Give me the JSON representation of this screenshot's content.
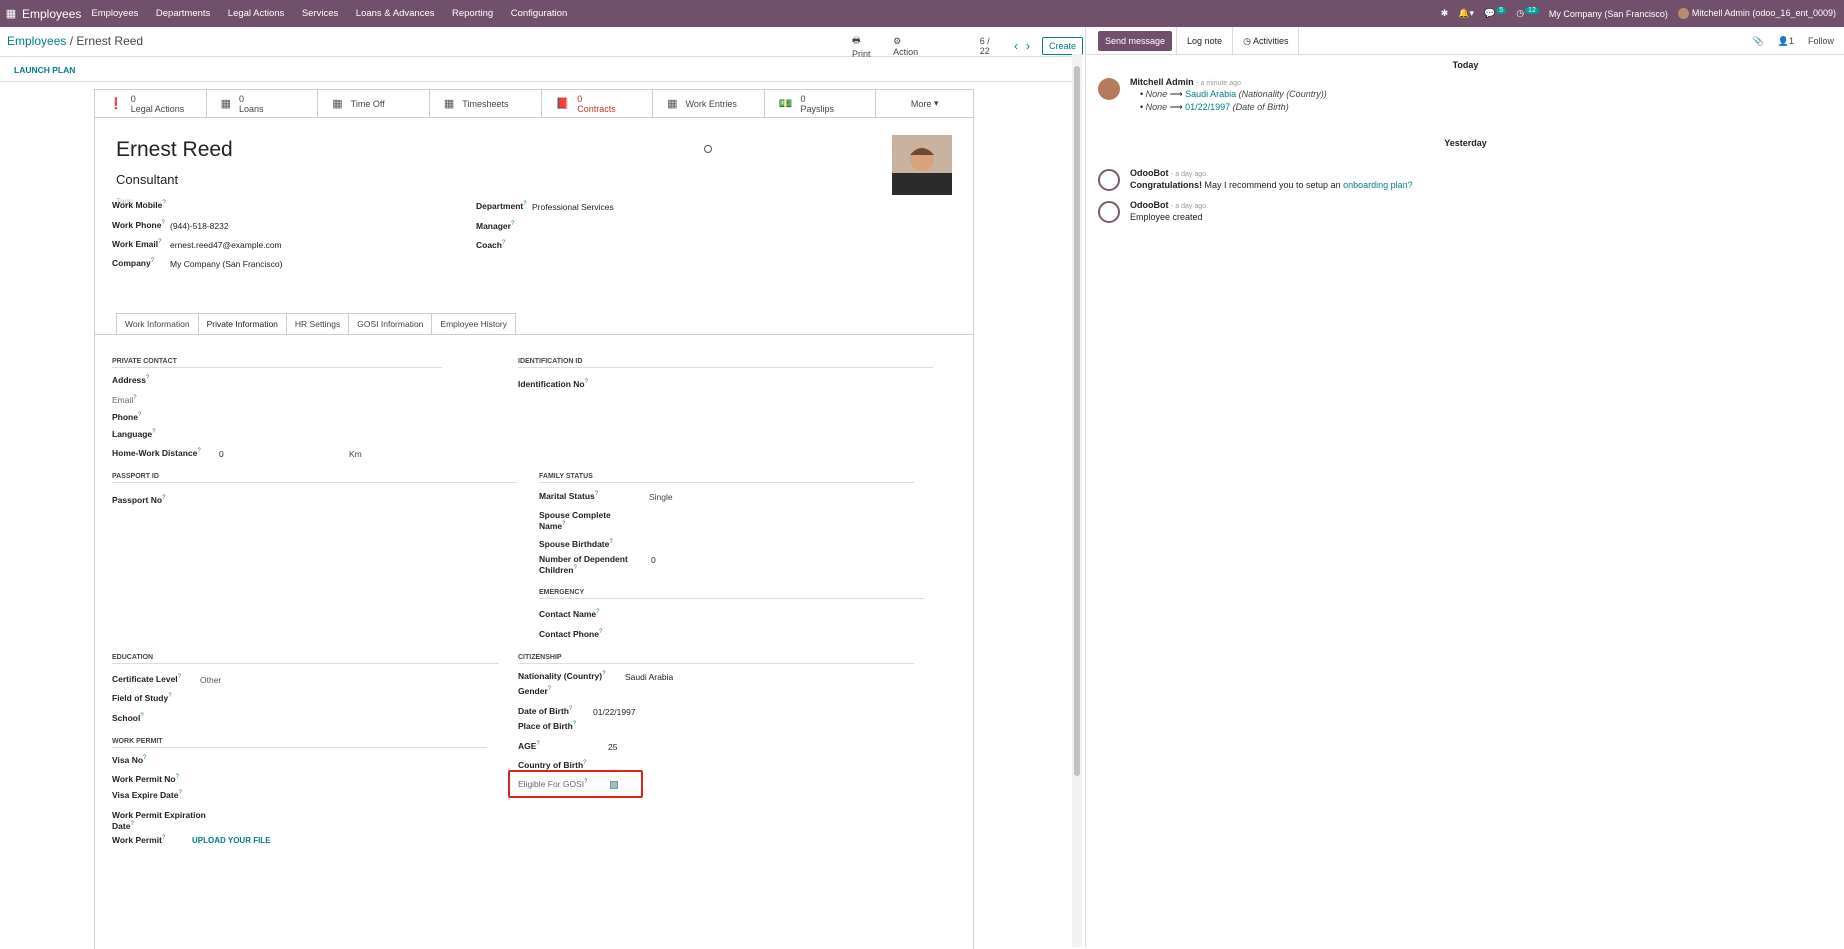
{
  "topbar": {
    "app_name": "Employees",
    "menu": [
      "Employees",
      "Departments",
      "Legal Actions",
      "Services",
      "Loans & Advances",
      "Reporting",
      "Configuration"
    ],
    "activity_count": "5",
    "clock_count": "12",
    "company": "My Company (San Francisco)",
    "user": "Mitchell Admin (odoo_16_ent_0009)"
  },
  "control_panel": {
    "breadcrumb_parent": "Employees",
    "breadcrumb_sep": " / ",
    "breadcrumb_current": "Ernest Reed",
    "print_label": "Print",
    "action_label": "Action",
    "pager": "6 / 22",
    "create_label": "Create"
  },
  "statusbar": {
    "launch_plan": "LAUNCH PLAN"
  },
  "smart_buttons": [
    {
      "icon": "exclamation-icon",
      "count": "0",
      "label": "Legal Actions"
    },
    {
      "icon": "calendar-icon",
      "count": "0",
      "label": "Loans"
    },
    {
      "icon": "calendar-icon",
      "count": "",
      "label": "Time Off"
    },
    {
      "icon": "calendar-icon",
      "count": "",
      "label": "Timesheets"
    },
    {
      "icon": "book-icon",
      "count": "0",
      "label": "Contracts"
    },
    {
      "icon": "calendar-icon",
      "count": "",
      "label": "Work Entries"
    },
    {
      "icon": "money-icon",
      "count": "0",
      "label": "Payslips"
    },
    {
      "icon": "",
      "count": "",
      "label": "More"
    }
  ],
  "employee": {
    "name": "Ernest Reed",
    "job_title": "Consultant",
    "tags_placeholder": "Tags",
    "work_mobile_label": "Work Mobile",
    "work_phone_label": "Work Phone",
    "work_phone": "(944)-518-8232",
    "work_email_label": "Work Email",
    "work_email": "ernest.reed47@example.com",
    "company_label": "Company",
    "company": "My Company (San Francisco)",
    "department_label": "Department",
    "department": "Professional Services",
    "manager_label": "Manager",
    "coach_label": "Coach"
  },
  "tabs": [
    "Work Information",
    "Private Information",
    "HR Settings",
    "GOSI Information",
    "Employee History"
  ],
  "private": {
    "private_contact": "PRIVATE CONTACT",
    "address": "Address",
    "email": "Email",
    "phone": "Phone",
    "language": "Language",
    "home_work_distance": "Home-Work Distance",
    "home_work_value": "0",
    "km": "Km",
    "identification_id": "IDENTIFICATION ID",
    "identification_no": "Identification No",
    "passport_id": "PASSPORT ID",
    "passport_no": "Passport No",
    "family_status": "FAMILY STATUS",
    "marital_status": "Marital Status",
    "marital_value": "Single",
    "spouse_name_1": "Spouse Complete",
    "spouse_name_2": "Name",
    "spouse_birthdate": "Spouse Birthdate",
    "dependent_1": "Number of Dependent",
    "dependent_2": "Children",
    "dependent_value": "0",
    "emergency": "EMERGENCY",
    "contact_name": "Contact Name",
    "contact_phone": "Contact Phone",
    "education": "EDUCATION",
    "certificate_level": "Certificate Level",
    "certificate_value": "Other",
    "field_of_study": "Field of Study",
    "school": "School",
    "citizenship": "CITIZENSHIP",
    "nationality": "Nationality (Country)",
    "nationality_value": "Saudi Arabia",
    "gender": "Gender",
    "dob": "Date of Birth",
    "dob_value": "01/22/1997",
    "pob": "Place of Birth",
    "age": "AGE",
    "age_value": "25",
    "country_of_birth": "Country of Birth",
    "eligible_gosi": "Eligible For GOSI",
    "eligible_gosi_checked": true,
    "work_permit": "WORK PERMIT",
    "visa_no": "Visa No",
    "work_permit_no": "Work Permit No",
    "visa_expire": "Visa Expire Date",
    "wp_exp_1": "Work Permit Expiration",
    "wp_exp_2": "Date",
    "work_permit_file": "Work Permit",
    "upload": "UPLOAD YOUR FILE"
  },
  "chatter": {
    "send_message": "Send message",
    "log_note": "Log note",
    "activities": "Activities",
    "followers_count": "1",
    "follow": "Follow",
    "today": "Today",
    "yesterday": "Yesterday",
    "messages": [
      {
        "author": "Mitchell Admin",
        "ago": "- a minute ago",
        "changes": [
          {
            "old": "None",
            "new": "Saudi Arabia",
            "field": "(Nationality (Country))"
          },
          {
            "old": "None",
            "new": "01/22/1997",
            "field": "(Date of Birth)"
          }
        ]
      },
      {
        "author": "OdooBot",
        "ago": "- a day ago",
        "text_bold": "Congratulations!",
        "text": " May I recommend you to setup an ",
        "link": "onboarding plan?"
      },
      {
        "author": "OdooBot",
        "ago": "- a day ago",
        "text": "Employee created"
      }
    ]
  }
}
